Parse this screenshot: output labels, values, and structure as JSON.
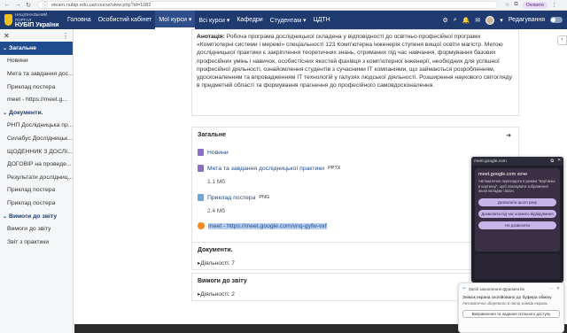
{
  "browser": {
    "url": "elearn.nubip.edu.ua/course/view.php?id=1082",
    "profile_label": "Оновити"
  },
  "navbar": {
    "logo_line1": "НАЦІОНАЛЬНИЙ ПОРТАЛ",
    "logo_line2": "НУБІП України",
    "items": [
      {
        "label": "Головна"
      },
      {
        "label": "Особистий кабінет"
      },
      {
        "label": "Мої курси ▾"
      },
      {
        "label": "Всі курси ▾"
      },
      {
        "label": "Кафедри"
      },
      {
        "label": "Студентам ▾"
      },
      {
        "label": "ЦДТН"
      }
    ],
    "edit_mode_label": "Редагування"
  },
  "sidebar": {
    "items": [
      {
        "label": "Загальне",
        "type": "section-active"
      },
      {
        "label": "Новини",
        "type": "item"
      },
      {
        "label": "Мета та завдання дос...",
        "type": "item"
      },
      {
        "label": "Приклад постера",
        "type": "item"
      },
      {
        "label": "meet - https://meet.g...",
        "type": "item"
      },
      {
        "label": "Документи.",
        "type": "section"
      },
      {
        "label": "РНП Дослідницька пр...",
        "type": "item"
      },
      {
        "label": "Силабус Дослідницьк...",
        "type": "item"
      },
      {
        "label": "ЩОДЕННИК З ДОСЛІ...",
        "type": "item"
      },
      {
        "label": "ДОГОВІР на проведе...",
        "type": "item"
      },
      {
        "label": "Результати дослідниц...",
        "type": "item"
      },
      {
        "label": "Приклад постера",
        "type": "item"
      },
      {
        "label": "Приклад постера",
        "type": "item"
      },
      {
        "label": "Вимоги до звіту",
        "type": "section"
      },
      {
        "label": "Вимоги до звіту",
        "type": "item"
      },
      {
        "label": "Звіт з практики",
        "type": "item"
      }
    ]
  },
  "description": {
    "label": "Анотація:",
    "text": " Робоча програма дослідницької складена у відповідності до освітньо-професійної програми «Комп'ютерні системи і мережі» спеціальності 123 Комп'ютерна інженерія ступеня вищої освіти магістр. Метою дослідницької практики є закріплення теоретичних знань, отриманих під час навчання, формування базових професійних умінь і навичок, особистісних якостей фахівця з комп'ютерної інженерії, необхідних для успішної професійної діяльності, ознайомлення студентів з сучасними ІТ компаніями, що займаються розробленням, удосконаленням та впровадженням ІТ технологій у галузях людської діяльності. Розширення наукового світогляду в предметній області та формування прагнення до професійного самовдосконалення."
  },
  "sections": {
    "general": {
      "title": "Загальне",
      "activities": [
        {
          "label": "Новини",
          "type": ""
        },
        {
          "label": "Мета та завдання дослідницької практики",
          "type": "PPTX",
          "size": "1.1 Мб"
        },
        {
          "label": "Приклад постера",
          "type": "PNG",
          "size": "2.4 Мб"
        },
        {
          "label": "meet - https://meet.google.com/vnq-gyfw-vxf",
          "type": ""
        }
      ]
    },
    "documents": {
      "title": "Документи.",
      "count": "Діяльності: 7"
    },
    "requirements": {
      "title": "Вимоги до звіту",
      "count": "Діяльності: 2"
    }
  },
  "meet_popup": {
    "host": "meet.google.com",
    "title": "meet.google.com хоче",
    "desc": "Автоматично переходити в режим \"Картинка в картинці\", щоб показувати зображення іншої вкладки і вікон.",
    "btn_allow_once": "Дозволити цього разу",
    "btn_allow_always": "Дозволити під час кожного відвідування",
    "btn_deny": "Не дозволяти"
  },
  "clipboard_toast": {
    "header": "Засіб захоплення фрагментів",
    "title": "Знімок екрана скопійовано до буфера обміну",
    "subtitle": "Автоматично збережено в папці знімків екрана.",
    "button": "Виправлення та надання спільного доступу"
  }
}
